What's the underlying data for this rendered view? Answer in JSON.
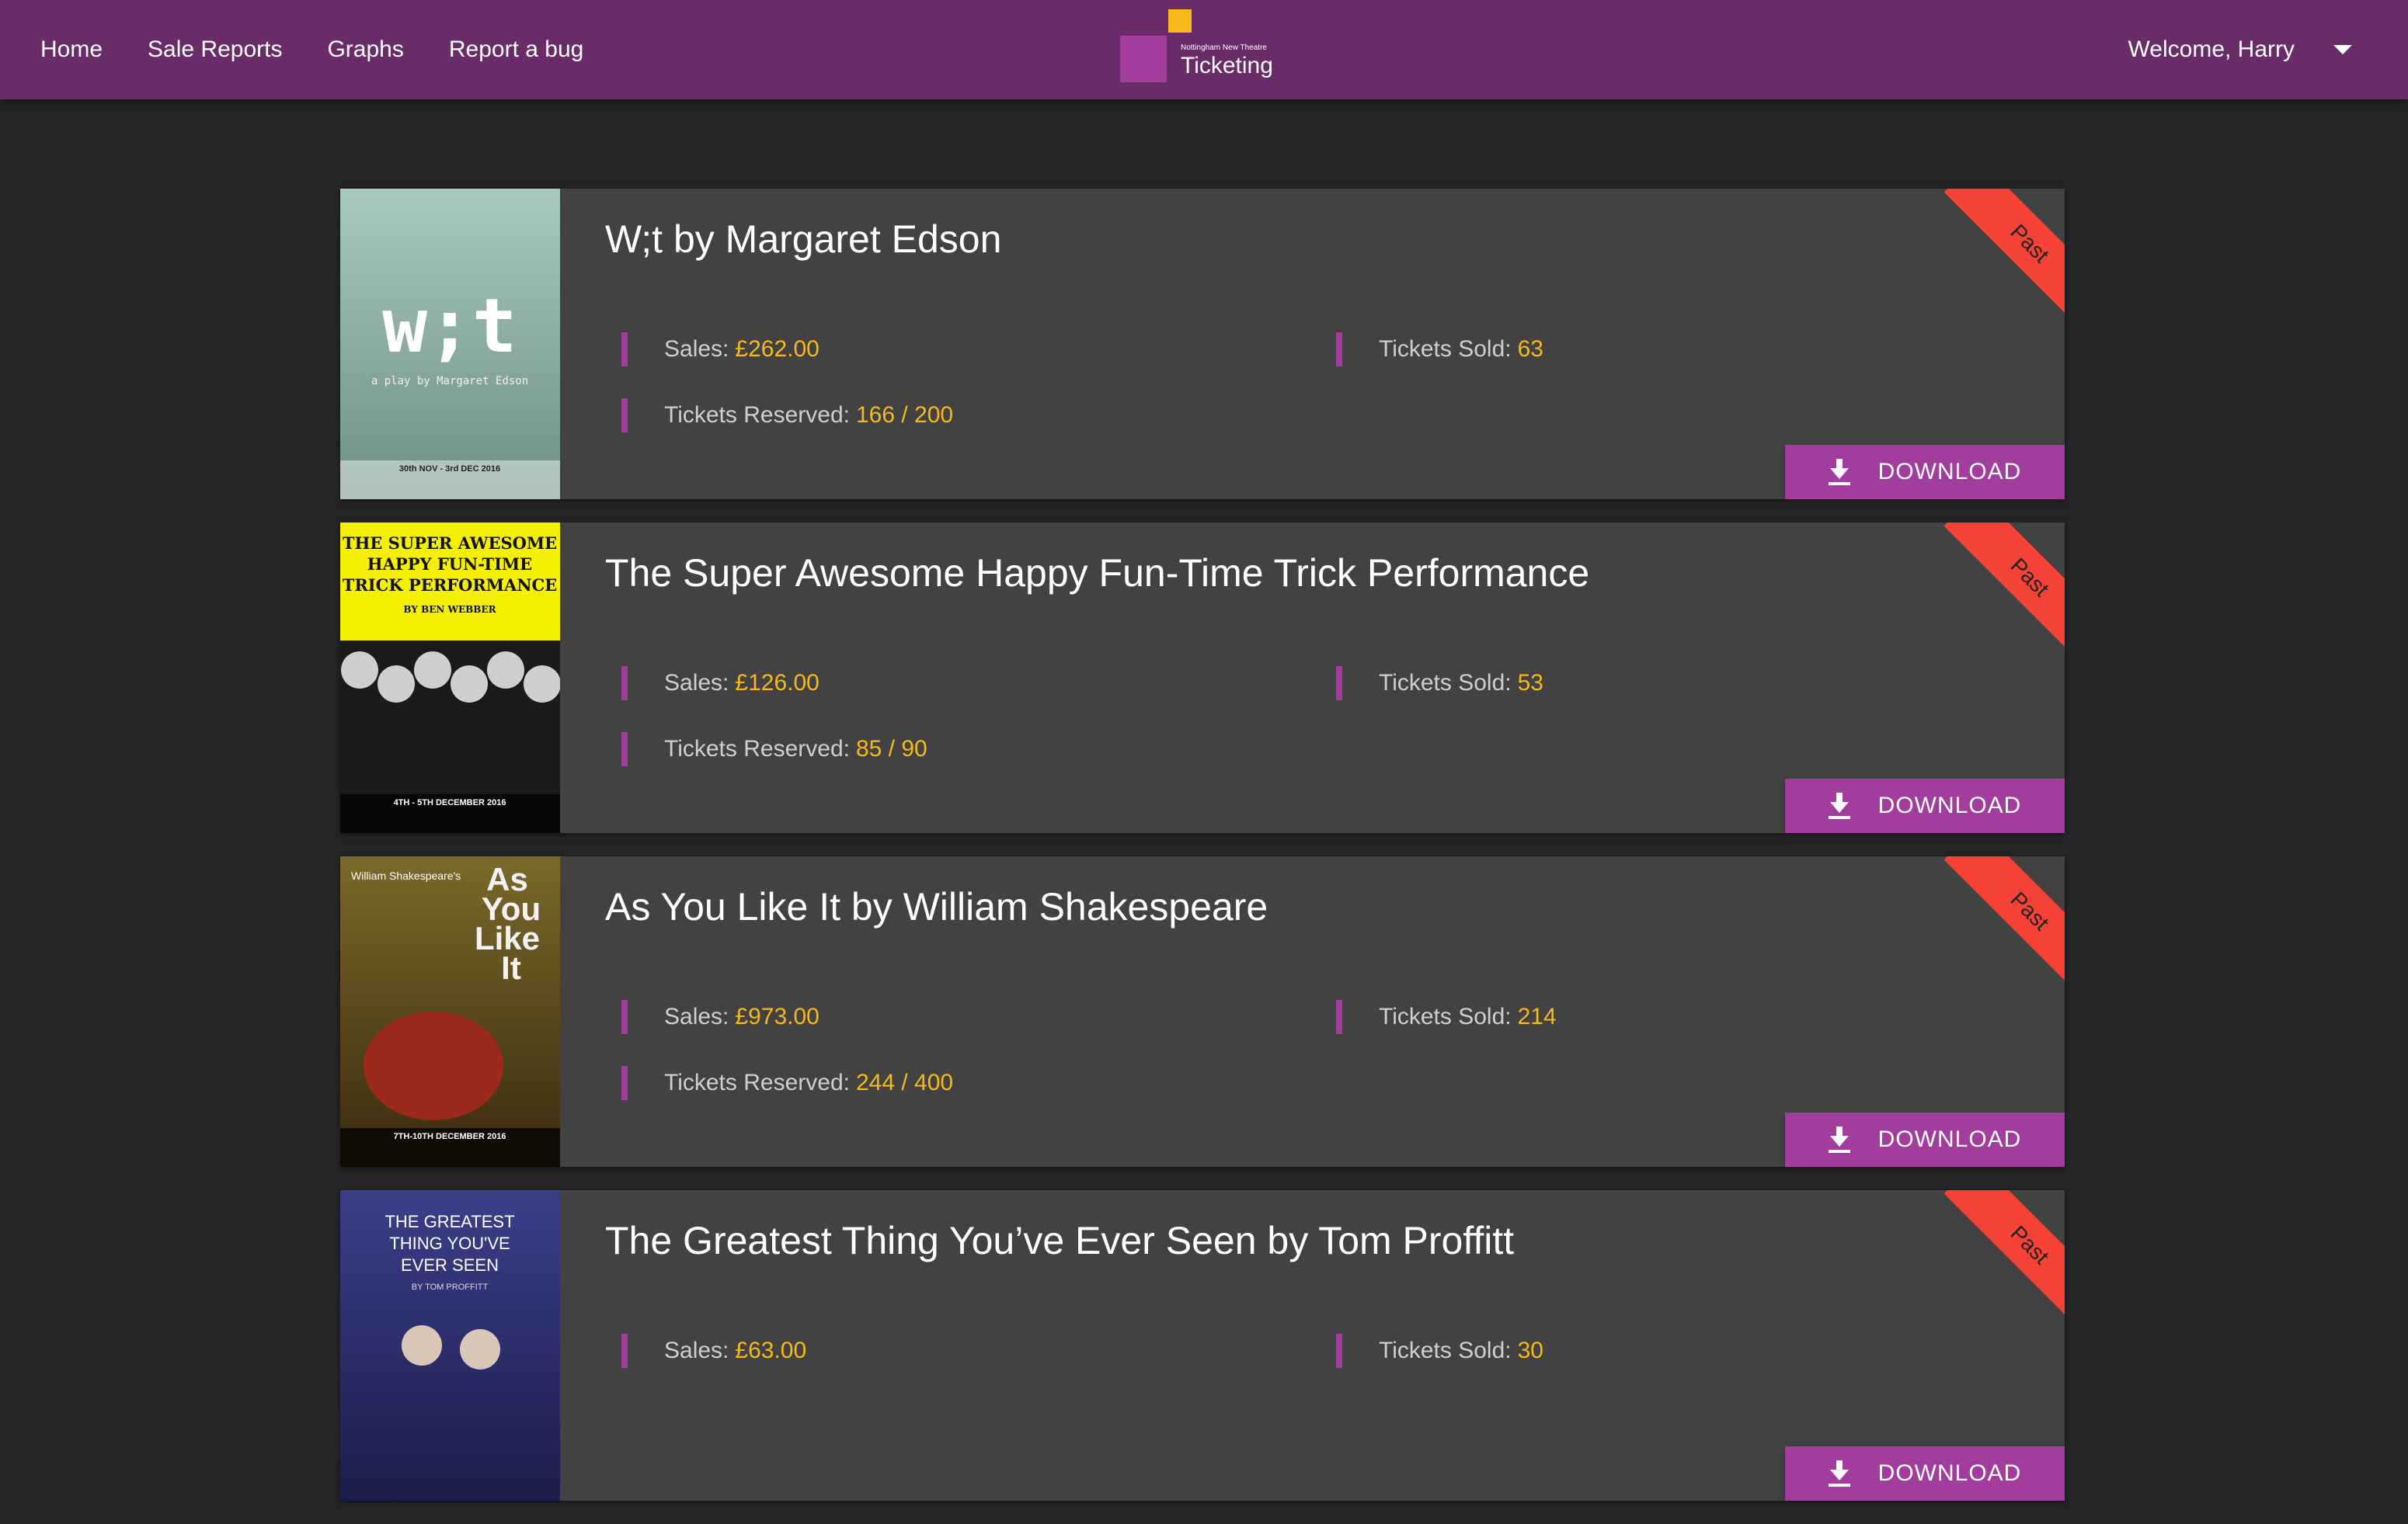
{
  "nav": {
    "links": [
      "Home",
      "Sale Reports",
      "Graphs",
      "Report a bug"
    ],
    "logo_small": "Nottingham New Theatre",
    "logo_text": "Ticketing",
    "user": "Welcome, Harry"
  },
  "labels": {
    "sales": "Sales:",
    "sold": "Tickets Sold:",
    "reserved": "Tickets Reserved:",
    "download": "DOWNLOAD",
    "badge": "Past"
  },
  "shows": [
    {
      "title": "W;t by Margaret Edson",
      "sales": "£262.00",
      "sold": "63",
      "reserved": "166 / 200",
      "poster": {
        "big": "w;t",
        "sub": "a play by Margaret Edson",
        "footer": "30th NOV - 3rd DEC 2016",
        "colors": [
          "#a9c9bf",
          "#6f8f85"
        ]
      }
    },
    {
      "title": "The Super Awesome Happy Fun-Time Trick Performance",
      "sales": "£126.00",
      "sold": "53",
      "reserved": "85 / 90",
      "poster": {
        "big": "THE SUPER AWESOME HAPPY FUN-TIME TRICK PERFORMANCE",
        "sub": "BY BEN WEBBER",
        "footer": "4TH - 5TH DECEMBER 2016",
        "colors": [
          "#f4f000",
          "#1a1a1a"
        ]
      }
    },
    {
      "title": "As You Like It by William Shakespeare",
      "sales": "£973.00",
      "sold": "214",
      "reserved": "244 / 400",
      "poster": {
        "big": "As You Like It",
        "sub": "William Shakespeare's",
        "footer": "7TH-10TH DECEMBER 2016",
        "colors": [
          "#7a6a2a",
          "#3a2a10"
        ]
      }
    },
    {
      "title": "The Greatest Thing You’ve Ever Seen by Tom Proffitt",
      "sales": "£63.00",
      "sold": "30",
      "reserved": "",
      "poster": {
        "big": "THE GREATEST THING YOU'VE EVER SEEN",
        "sub": "BY TOM PROFFITT",
        "footer": "",
        "colors": [
          "#3b3f8a",
          "#1b1d4a"
        ]
      }
    }
  ]
}
